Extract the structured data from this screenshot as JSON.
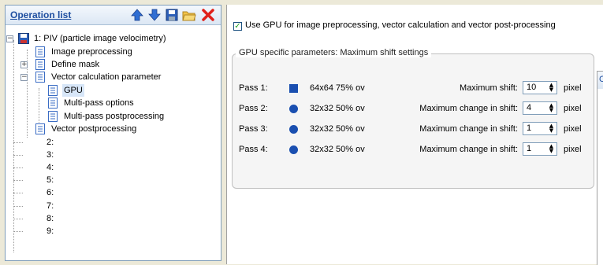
{
  "operation_list": {
    "title": "Operation list",
    "toolbar": [
      "arrow-up-icon",
      "arrow-down-icon",
      "save-icon",
      "open-folder-icon",
      "delete-icon"
    ],
    "tree": [
      {
        "label": "1: PIV (particle image velocimetry)",
        "level": 0,
        "expander": "−",
        "icon": "floppy"
      },
      {
        "label": "Image preprocessing",
        "level": 1,
        "expander": "",
        "icon": "doc"
      },
      {
        "label": "Define mask",
        "level": 1,
        "expander": "+",
        "icon": "doc"
      },
      {
        "label": "Vector calculation parameter",
        "level": 1,
        "expander": "−",
        "icon": "doc"
      },
      {
        "label": "GPU",
        "level": 2,
        "expander": "",
        "icon": "doc",
        "selected": true
      },
      {
        "label": "Multi-pass options",
        "level": 2,
        "expander": "",
        "icon": "doc"
      },
      {
        "label": "Multi-pass postprocessing",
        "level": 2,
        "expander": "",
        "icon": "doc"
      },
      {
        "label": "Vector postprocessing",
        "level": 1,
        "expander": "",
        "icon": "doc"
      },
      {
        "label": "2:",
        "level": 0,
        "expander": "",
        "icon": ""
      },
      {
        "label": "3:",
        "level": 0,
        "expander": "",
        "icon": ""
      },
      {
        "label": "4:",
        "level": 0,
        "expander": "",
        "icon": ""
      },
      {
        "label": "5:",
        "level": 0,
        "expander": "",
        "icon": ""
      },
      {
        "label": "6:",
        "level": 0,
        "expander": "",
        "icon": ""
      },
      {
        "label": "7:",
        "level": 0,
        "expander": "",
        "icon": ""
      },
      {
        "label": "8:",
        "level": 0,
        "expander": "",
        "icon": ""
      },
      {
        "label": "9:",
        "level": 0,
        "expander": "",
        "icon": ""
      }
    ]
  },
  "gpu_option": {
    "checked": true,
    "label": "Use GPU for image preprocessing, vector calculation and vector post-processing"
  },
  "gpu_group": {
    "title": "GPU specific parameters: Maximum shift settings",
    "passes": [
      {
        "label": "Pass 1:",
        "marker": "square",
        "setting": "64x64 75% ov",
        "shift_label": "Maximum shift:",
        "value": "10",
        "unit": "pixel"
      },
      {
        "label": "Pass 2:",
        "marker": "circle",
        "setting": "32x32 50% ov",
        "shift_label": "Maximum change in shift:",
        "value": "4",
        "unit": "pixel"
      },
      {
        "label": "Pass 3:",
        "marker": "circle",
        "setting": "32x32 50% ov",
        "shift_label": "Maximum change in shift:",
        "value": "1",
        "unit": "pixel"
      },
      {
        "label": "Pass 4:",
        "marker": "circle",
        "setting": "32x32 50% ov",
        "shift_label": "Maximum change in shift:",
        "value": "1",
        "unit": "pixel"
      }
    ]
  },
  "overlay_panel": {
    "title_fragment": "C"
  },
  "colors": {
    "accent": "#1a4fb0",
    "header_text": "#1f4fa0",
    "delete": "#e0201a"
  }
}
